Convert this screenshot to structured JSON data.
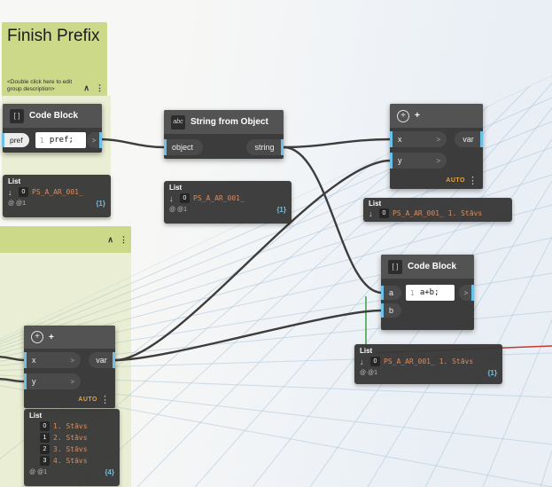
{
  "colors": {
    "accent_blue": "#6AC0E7",
    "value_orange": "#E08A57",
    "group_green": "#CBD989",
    "lacing_orange": "#E8A33D",
    "axis_red": "#C8372D",
    "axis_green": "#3C9E45"
  },
  "ui": {
    "collapse_icon": "∧",
    "menu_icon": "⋮",
    "expand_arrow": "↓",
    "chevron": ">",
    "plus_icon": "+"
  },
  "groups": {
    "finish_prefix": {
      "title": "Finish Prefix",
      "description": "<Double click here to edit group description>"
    }
  },
  "nodes": {
    "code_block_prefix": {
      "title": "Code Block",
      "icon": "[ ]",
      "input": "pref",
      "line": "1",
      "code": "pref;"
    },
    "string_from_object": {
      "title": "String from Object",
      "icon": "abc",
      "input": "object",
      "output": "string"
    },
    "plus_top": {
      "title": "+",
      "input_x": "x",
      "input_y": "y",
      "output": "var",
      "lacing": "AUTO"
    },
    "code_block_concat": {
      "title": "Code Block",
      "icon": "[ ]",
      "input_a": "a",
      "input_b": "b",
      "line": "1",
      "code": "a+b;"
    },
    "plus_bottom": {
      "title": "+",
      "input_x": "x",
      "input_y": "y",
      "output": "var",
      "lacing": "AUTO"
    }
  },
  "previews": {
    "prefix_list": {
      "label": "List",
      "items": [
        {
          "index": "0",
          "value": "PS_A_AR_001_"
        }
      ],
      "footer_icons": "@ @1",
      "depth": "{1}"
    },
    "string_list": {
      "label": "List",
      "items": [
        {
          "index": "0",
          "value": "PS_A_AR_001_"
        }
      ],
      "footer_icons": "@ @1",
      "depth": "{1}"
    },
    "plus_top_list": {
      "label": "List",
      "items": [
        {
          "index": "0",
          "value": "PS_A_AR_001_ 1. Stāvs"
        }
      ]
    },
    "concat_list": {
      "label": "List",
      "items": [
        {
          "index": "0",
          "value": "PS_A_AR_001_ 1. Stāvs"
        }
      ],
      "footer_icons": "@ @1",
      "depth": "{1}"
    },
    "levels_list": {
      "label": "List",
      "items": [
        {
          "index": "0",
          "value": "1. Stāvs"
        },
        {
          "index": "1",
          "value": "2. Stāvs"
        },
        {
          "index": "2",
          "value": "3. Stāvs"
        },
        {
          "index": "3",
          "value": "4. Stāvs"
        }
      ],
      "footer_icons": "@ @1",
      "depth": "{4}"
    }
  }
}
